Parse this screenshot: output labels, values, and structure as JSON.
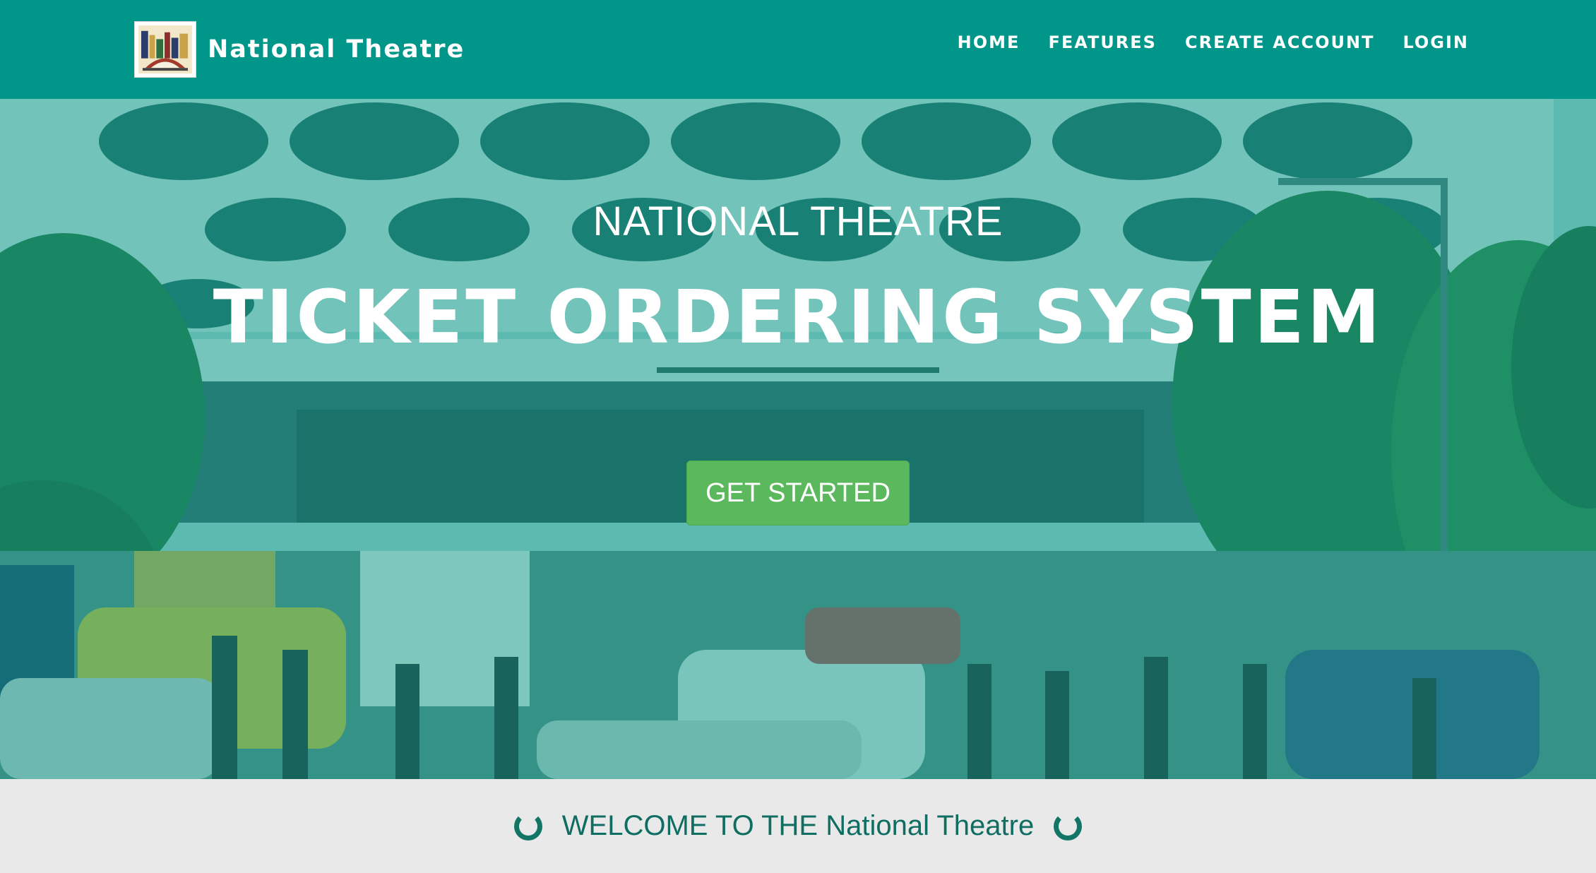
{
  "brand": {
    "name": "National Theatre",
    "logo_icon": "theatre-logo-icon"
  },
  "nav": {
    "items": [
      {
        "label": "HOME"
      },
      {
        "label": "FEATURES"
      },
      {
        "label": "CREATE ACCOUNT"
      },
      {
        "label": "LOGIN"
      }
    ]
  },
  "hero": {
    "subtitle": "NATIONAL THEATRE",
    "title": "TICKET ORDERING SYSTEM",
    "cta_label": "GET STARTED",
    "background_image": "national-theatre-building-photo"
  },
  "welcome": {
    "text": "WELCOME TO THE National Theatre",
    "icon": "spinner-icon"
  },
  "colors": {
    "primary": "#00978a",
    "overlay": "#009688",
    "button": "#5cb85c",
    "welcome_text": "#0f6e61",
    "welcome_bg": "#e9e9e9"
  }
}
